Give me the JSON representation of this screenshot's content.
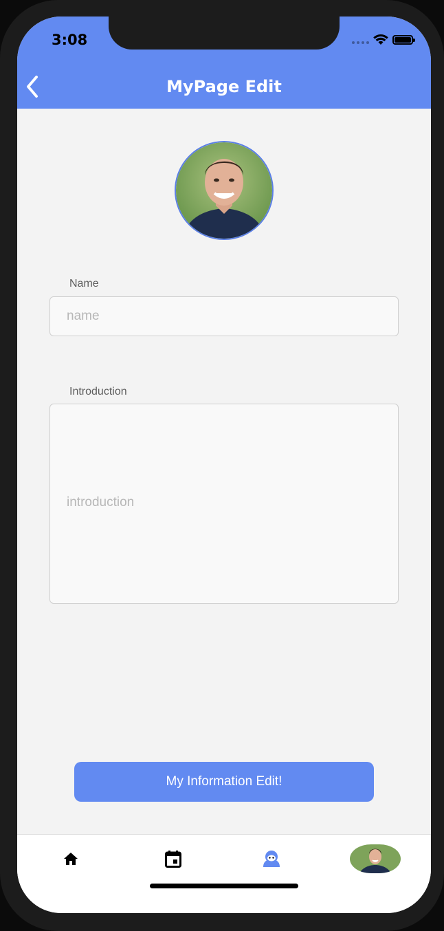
{
  "status_bar": {
    "time": "3:08"
  },
  "header": {
    "title": "MyPage Edit"
  },
  "form": {
    "name": {
      "label": "Name",
      "value": "",
      "placeholder": "name"
    },
    "introduction": {
      "label": "Introduction",
      "value": "",
      "placeholder": "introduction"
    },
    "submit_label": "My Information Edit!"
  },
  "tab_bar": {
    "items": [
      {
        "icon": "home-icon"
      },
      {
        "icon": "calendar-icon"
      },
      {
        "icon": "character-icon"
      },
      {
        "icon": "profile-avatar"
      }
    ]
  },
  "colors": {
    "accent": "#628af1",
    "background": "#f3f3f3"
  }
}
